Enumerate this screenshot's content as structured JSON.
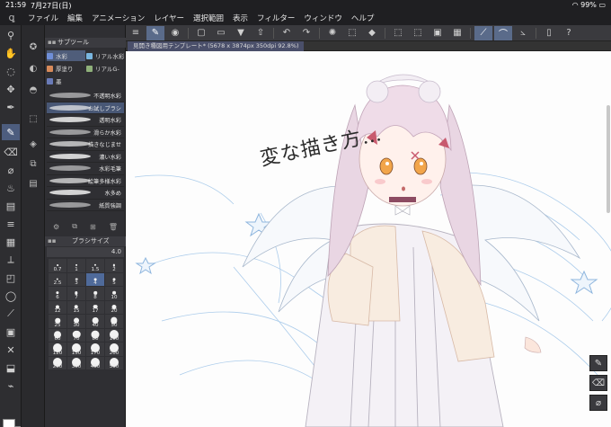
{
  "status": {
    "time": "21:59",
    "date": "7月27日(日)",
    "battery": "99%"
  },
  "menu": [
    "ファイル",
    "編集",
    "アニメーション",
    "レイヤー",
    "選択範囲",
    "表示",
    "フィルター",
    "ウィンドウ",
    "ヘルプ"
  ],
  "document": {
    "tab_label": "見開き種図用テンプレート* (5678 x 3874px 350dpi 92.8%)"
  },
  "subtool_panel": {
    "title": "サブツール",
    "groups": [
      {
        "label": "水彩",
        "color": "#6f8fd8",
        "active": true
      },
      {
        "label": "リアル水彩",
        "color": "#79b6e0",
        "active": false
      },
      {
        "label": "厚塗り",
        "color": "#d88a5a",
        "active": false
      },
      {
        "label": "リアルG-",
        "color": "#8fb07a",
        "active": false
      },
      {
        "label": "墨",
        "color": "#6a7bb8",
        "active": false
      }
    ],
    "brushes": [
      {
        "name": "不透明水彩",
        "active": false
      },
      {
        "name": "お試しブラシ",
        "active": true
      },
      {
        "name": "透明水彩",
        "active": false
      },
      {
        "name": "滑らか水彩",
        "active": false
      },
      {
        "name": "描きなじませ",
        "active": false
      },
      {
        "name": "濃い水彩",
        "active": false
      },
      {
        "name": "水彩毛筆",
        "active": false
      },
      {
        "name": "絵筆多様水彩",
        "active": false
      },
      {
        "name": "水多め",
        "active": false
      },
      {
        "name": "紙質強調",
        "active": false
      }
    ]
  },
  "brush_size": {
    "title": "ブラシサイズ",
    "value": "4.0",
    "sizes": [
      "0.7",
      "1",
      "1.5",
      "2",
      "2.5",
      "3",
      "4",
      "5",
      "6",
      "7",
      "8",
      "10",
      "12",
      "15",
      "17",
      "20",
      "25",
      "30",
      "40",
      "50",
      "60",
      "70",
      "80",
      "100",
      "120",
      "150",
      "170",
      "200",
      "250",
      "300",
      "400",
      "500"
    ],
    "selected": "4"
  },
  "canvas": {
    "handwriting": "変な描き方…"
  },
  "colors": {
    "main": "#ffffff",
    "sub": "#2a2a2a",
    "accent": "#4d5d7e"
  }
}
